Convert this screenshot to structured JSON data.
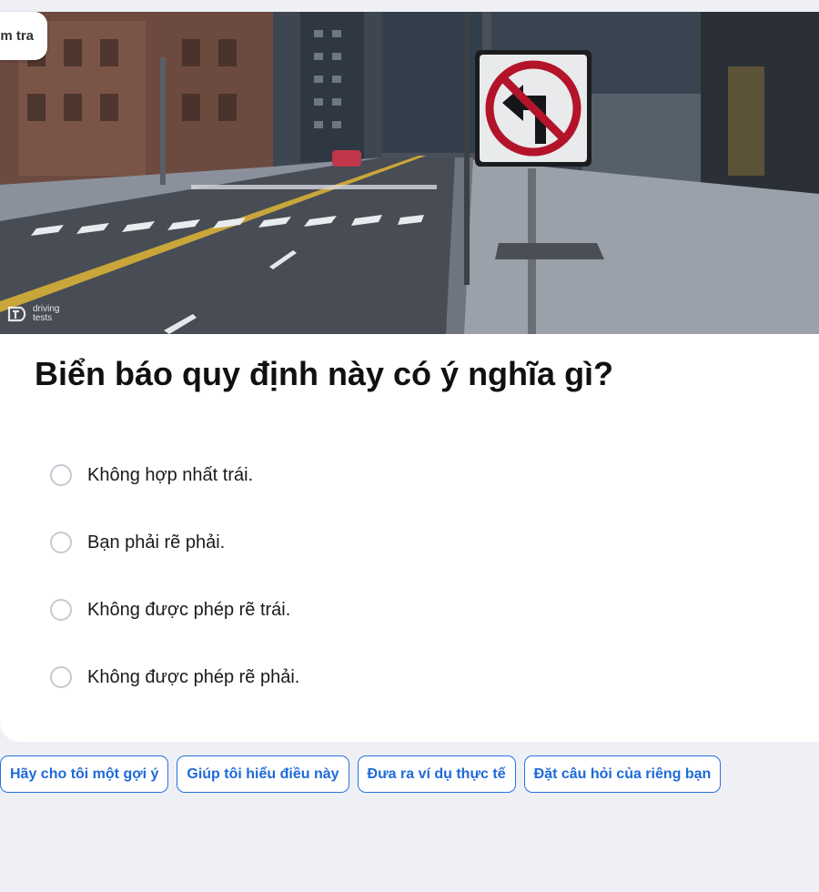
{
  "tag": {
    "label": "m tra"
  },
  "watermark": {
    "text_top": "driving",
    "text_bottom": "tests"
  },
  "question": {
    "title": "Biển báo quy định này có ý nghĩa gì?",
    "options": [
      "Không hợp nhất trái.",
      "Bạn phải rẽ phải.",
      "Không được phép rẽ trái.",
      "Không được phép rẽ phải."
    ]
  },
  "suggestions": [
    "Hãy cho tôi một gợi ý",
    "Giúp tôi hiểu điều này",
    "Đưa ra ví dụ thực tế",
    "Đặt câu hỏi của riêng bạn"
  ],
  "colors": {
    "accent": "#1e6ad9",
    "background": "#eef0f6",
    "card": "#ffffff",
    "sign_red": "#b3142a"
  },
  "icons": {
    "sign": "no-left-turn-sign-icon",
    "radio": "radio-unselected-icon",
    "logo": "driving-tests-logo-icon"
  }
}
